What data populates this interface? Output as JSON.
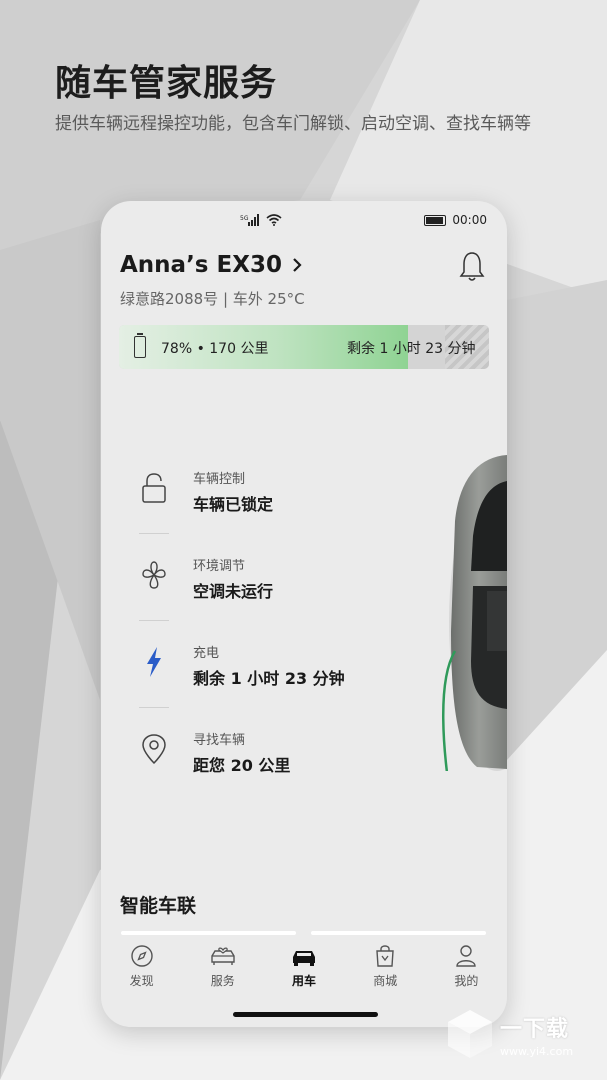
{
  "hero": {
    "title": "随车管家服务",
    "subtitle": "提供车辆远程操控功能，包含车门解锁、启动空调、查找车辆等"
  },
  "status_bar": {
    "network": "5G",
    "time": "00:00"
  },
  "vehicle": {
    "name": "Anna’s EX30",
    "location": "绿意路2088号 | 车外 25°C"
  },
  "charge": {
    "level_percent": 78,
    "summary": "78% • 170 公里",
    "remaining": "剩余 1 小时 23 分钟"
  },
  "controls": [
    {
      "icon": "lock-icon",
      "title": "车辆控制",
      "status": "车辆已锁定"
    },
    {
      "icon": "fan-icon",
      "title": "环境调节",
      "status": "空调未运行"
    },
    {
      "icon": "lightning-icon",
      "title": "充电",
      "status": "剩余 1 小时 23 分钟"
    },
    {
      "icon": "location-pin-icon",
      "title": "寻找车辆",
      "status": "距您 20 公里"
    }
  ],
  "section": {
    "title": "智能车联"
  },
  "tabs": [
    {
      "icon": "compass-icon",
      "label": "发现"
    },
    {
      "icon": "car-heart-icon",
      "label": "服务"
    },
    {
      "icon": "car-icon",
      "label": "用车",
      "active": true
    },
    {
      "icon": "shopping-bag-icon",
      "label": "商城"
    },
    {
      "icon": "person-icon",
      "label": "我的"
    }
  ],
  "watermark": {
    "brand": "一下载",
    "url": "www.yi4.com"
  },
  "colors": {
    "charge_green": "#8fd393",
    "lightning_blue": "#2a5cc8",
    "cable_green": "#2f9a5a"
  }
}
